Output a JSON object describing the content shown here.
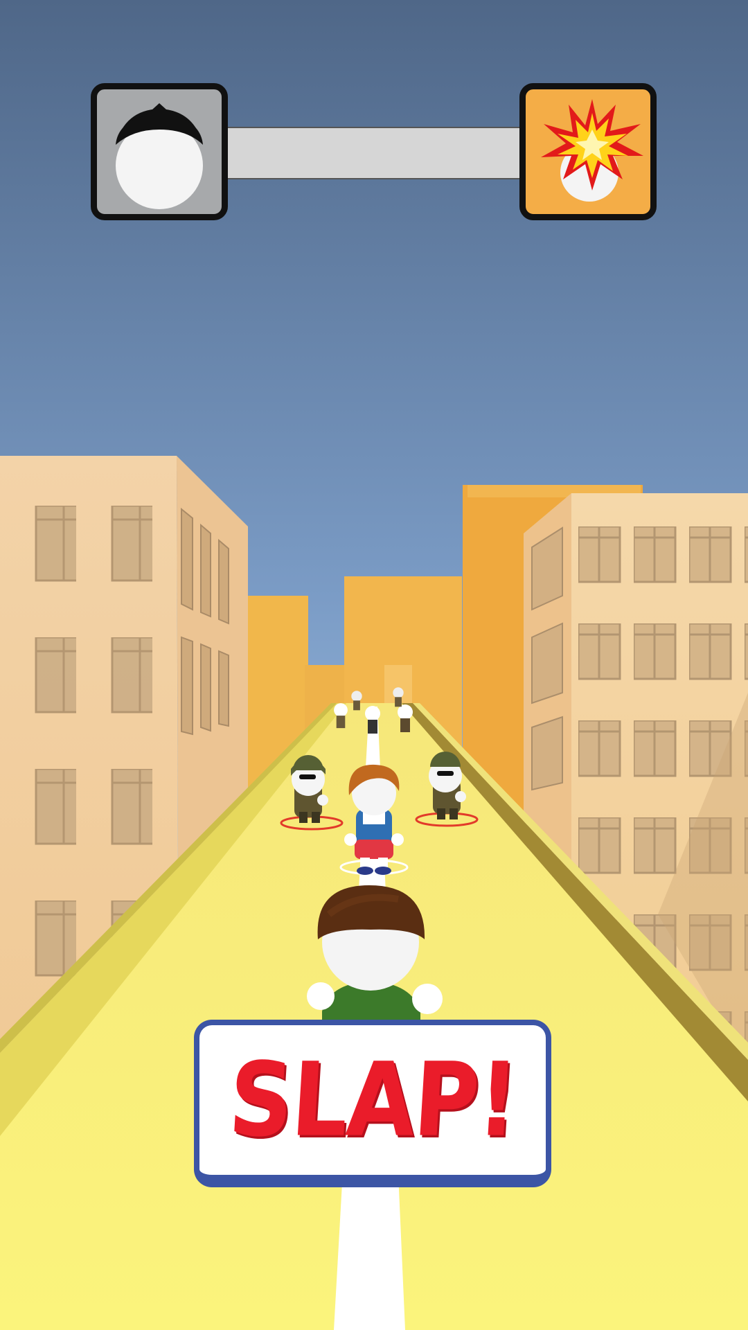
{
  "hud": {
    "progress": 0.0,
    "start_icon": "player-head-icon",
    "end_icon": "slapped-head-explosion-icon",
    "colors": {
      "start_box": "#a7a9ab",
      "end_box": "#f4ad47",
      "track": "#d6d6d6",
      "fill": "#f2a43a"
    }
  },
  "action_button": {
    "label": "SLAP!",
    "text_color": "#ea1c2a",
    "border_color": "#3c55a5"
  },
  "scene": {
    "characters": [
      "player",
      "kid-target",
      "soldier-left",
      "soldier-right",
      "distant-crowd"
    ],
    "colors": {
      "sky_top": "#4f6788",
      "sky_bottom": "#b4d6f0",
      "road": "#f7ee75",
      "buildings": "#f3c979"
    }
  }
}
